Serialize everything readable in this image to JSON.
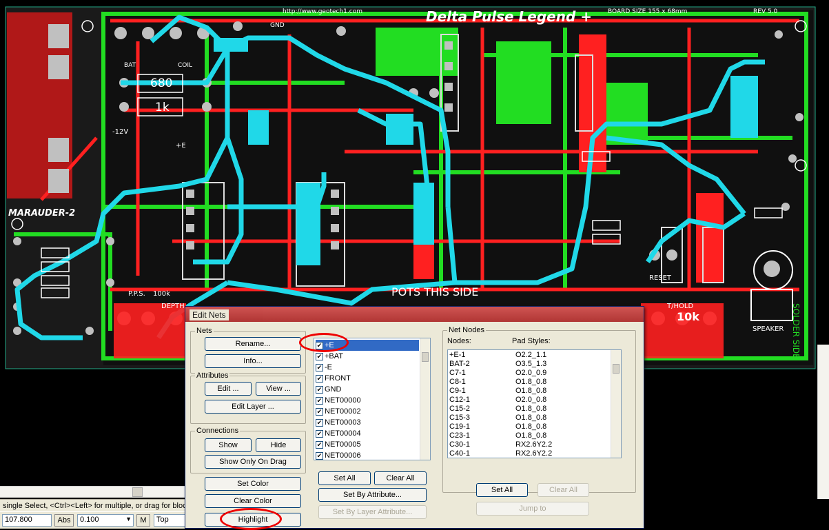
{
  "pcb": {
    "url": "http://www.geotech1.com",
    "brand": "Delta Pulse Legend +",
    "board_size": "BOARD SIZE 155 x 68mm",
    "rev": "REV 5.0",
    "marauder": "MARAUDER-2",
    "pots_side": "POTS THIS SIDE",
    "solder_side": "SOLDER SIDE",
    "speaker": "SPEAKER",
    "reset": "RESET",
    "pps": "P.P.S.",
    "depth": "DEPTH",
    "thold": "T/HOLD",
    "k10": "10k",
    "k100": "100k",
    "r680": "680",
    "r1k": "1k",
    "bat": "BAT",
    "coil": "COIL",
    "gnd": "GND",
    "minus12v": "-12V",
    "pluse": "+E",
    "colors": {
      "top_copper": "#ff2020",
      "bottom_copper": "#20dd20",
      "highlight": "#20d8e8",
      "pads": "#c0c0c0"
    }
  },
  "status": {
    "hint": "single Select, <Ctrl><Left> for multiple, or drag for block",
    "coord": "107.800",
    "abs": "Abs",
    "grid": "0.100",
    "m": "M",
    "layer": "Top"
  },
  "dialog": {
    "title": "Edit Nets",
    "nets_group": "Nets",
    "rename": "Rename...",
    "info": "Info...",
    "attributes_group": "Attributes",
    "edit": "Edit ...",
    "view": "View ...",
    "edit_layer": "Edit Layer ...",
    "connections_group": "Connections",
    "show": "Show",
    "hide": "Hide",
    "show_only_on_drag": "Show Only On Drag",
    "set_color": "Set Color",
    "clear_color": "Clear Color",
    "highlight": "Highlight",
    "set_all": "Set All",
    "clear_all": "Clear All",
    "set_by_attribute": "Set By Attribute...",
    "set_by_layer_attribute": "Set By Layer Attribute...",
    "net_list": [
      "+E",
      "+BAT",
      "-E",
      "FRONT",
      "GND",
      "NET00000",
      "NET00002",
      "NET00003",
      "NET00004",
      "NET00005",
      "NET00006"
    ],
    "net_nodes_group": "Net Nodes",
    "nodes_header": "Nodes:",
    "pad_styles_header": "Pad Styles:",
    "nodes": [
      {
        "node": "+E-1",
        "pad": "O2.2_1.1"
      },
      {
        "node": "BAT-2",
        "pad": "O3.5_1.3"
      },
      {
        "node": "C7-1",
        "pad": "O2.0_0.9"
      },
      {
        "node": "C8-1",
        "pad": "O1.8_0.8"
      },
      {
        "node": "C9-1",
        "pad": "O1.8_0.8"
      },
      {
        "node": "C12-1",
        "pad": "O2.0_0.8"
      },
      {
        "node": "C15-2",
        "pad": "O1.8_0.8"
      },
      {
        "node": "C15-3",
        "pad": "O1.8_0.8"
      },
      {
        "node": "C19-1",
        "pad": "O1.8_0.8"
      },
      {
        "node": "C23-1",
        "pad": "O1.8_0.8"
      },
      {
        "node": "C30-1",
        "pad": "RX2.6Y2.2"
      },
      {
        "node": "C40-1",
        "pad": "RX2.6Y2.2"
      }
    ],
    "nodes_set_all": "Set All",
    "nodes_clear_all": "Clear All",
    "jump_to": "Jump to"
  }
}
